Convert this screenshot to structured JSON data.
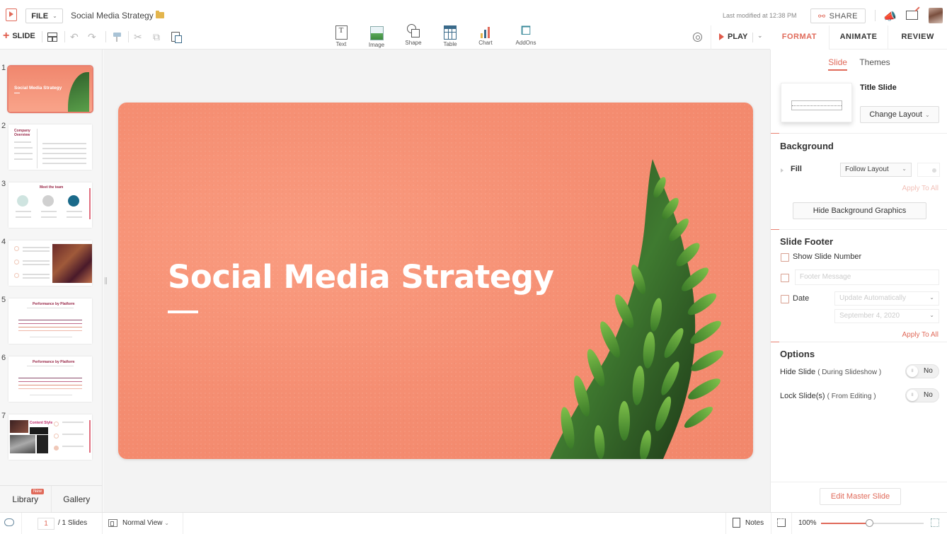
{
  "app": {
    "document_title": "Social Media Strategy",
    "file_menu_label": "FILE",
    "last_modified": "Last modified at 12:38 PM",
    "share_label": "SHARE"
  },
  "toolbar": {
    "add_slide_label": "SLIDE",
    "insert_items": [
      {
        "label": "Text",
        "icon": "text-box-icon"
      },
      {
        "label": "Image",
        "icon": "image-icon"
      },
      {
        "label": "Shape",
        "icon": "shape-icon"
      },
      {
        "label": "Table",
        "icon": "table-icon"
      },
      {
        "label": "Chart",
        "icon": "chart-icon"
      },
      {
        "label": "AddOns",
        "icon": "puzzle-icon"
      }
    ],
    "play_label": "PLAY"
  },
  "right_tabs": [
    {
      "label": "FORMAT",
      "active": true
    },
    {
      "label": "ANIMATE",
      "active": false
    },
    {
      "label": "REVIEW",
      "active": false
    }
  ],
  "slides_panel": {
    "slides": [
      {
        "number": "1",
        "title": "Social Media Strategy",
        "selected": true
      },
      {
        "number": "2",
        "title": "Company Overview"
      },
      {
        "number": "3",
        "title": "Meet the team"
      },
      {
        "number": "4",
        "title": ""
      },
      {
        "number": "5",
        "title": "Performance by Platform"
      },
      {
        "number": "6",
        "title": "Performance by Platform"
      },
      {
        "number": "7",
        "title": "Content Style"
      }
    ],
    "library_label": "Library",
    "library_badge": "New",
    "gallery_label": "Gallery"
  },
  "slide": {
    "title": "Social Media Strategy",
    "background_color": "#f58e72"
  },
  "format_panel": {
    "subtabs": [
      {
        "label": "Slide",
        "active": true
      },
      {
        "label": "Themes",
        "active": false
      }
    ],
    "layout_name": "Title Slide",
    "change_layout_label": "Change Layout",
    "background": {
      "title": "Background",
      "fill_label": "Fill",
      "fill_value": "Follow Layout",
      "apply_to_all_label": "Apply To All",
      "hide_graphics_label": "Hide Background Graphics"
    },
    "footer": {
      "title": "Slide Footer",
      "show_slide_number_label": "Show Slide Number",
      "show_slide_number_checked": false,
      "footer_message_placeholder": "Footer Message",
      "footer_message_checked": false,
      "date_label": "Date",
      "date_checked": false,
      "date_mode": "Update Automatically",
      "date_value": "September 4, 2020",
      "apply_to_all_label": "Apply To All"
    },
    "options": {
      "title": "Options",
      "hide_slide_label": "Hide Slide",
      "hide_slide_sub": "( During Slideshow )",
      "hide_slide_value": "No",
      "lock_slide_label": "Lock Slide(s)",
      "lock_slide_sub": "( From Editing )",
      "lock_slide_value": "No"
    },
    "edit_master_label": "Edit Master Slide"
  },
  "statusbar": {
    "current_page": "1",
    "total_pages": "/ 1 Slides",
    "view_mode": "Normal View",
    "notes_label": "Notes",
    "zoom_level": "100%",
    "zoom_fraction": 0.47
  },
  "colors": {
    "accent": "#e06a5a",
    "slide_bg": "#f58e72"
  }
}
